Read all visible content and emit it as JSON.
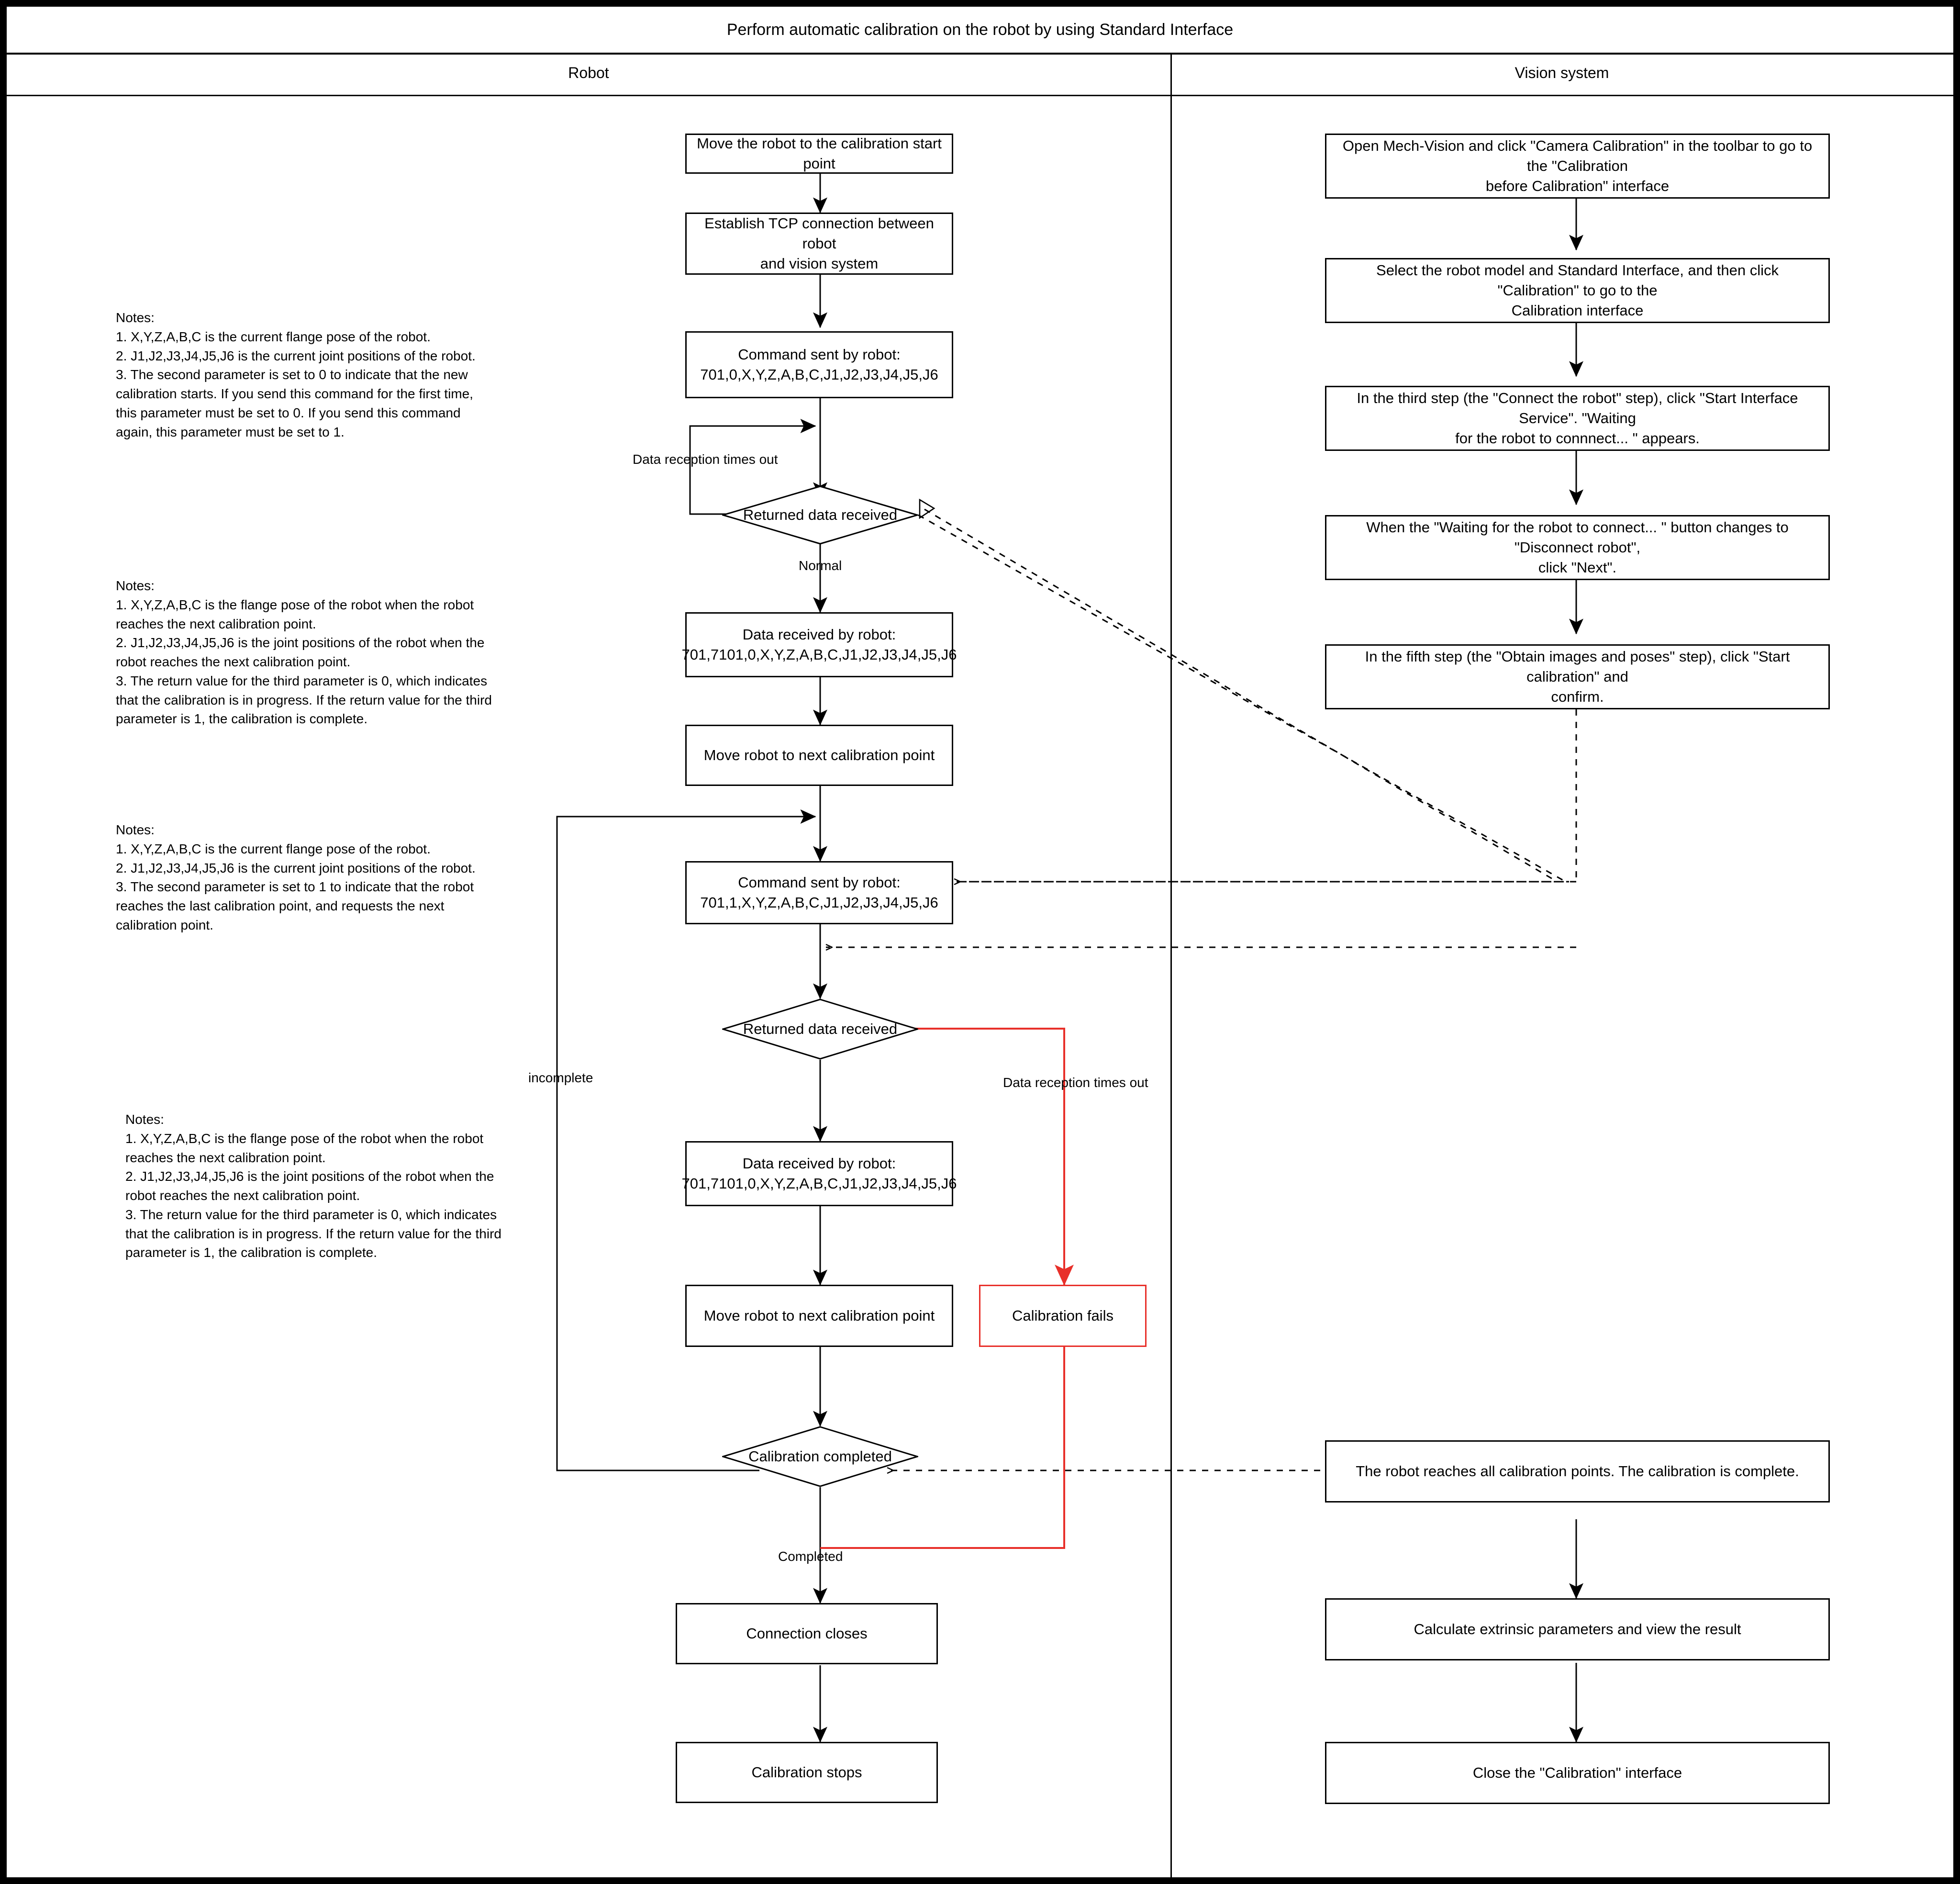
{
  "title": "Perform automatic calibration on the robot by using Standard Interface",
  "lanes": [
    {
      "label": "Robot"
    },
    {
      "label": "Vision system"
    }
  ],
  "colors": {
    "stroke": "#000000",
    "fail": "#e8302a",
    "background": "#ffffff",
    "page_border": "#000000"
  },
  "robot_nodes": [
    {
      "id": "r1",
      "text": "Move the robot to the calibration start point"
    },
    {
      "id": "r2",
      "text": "Establish TCP connection between robot\nand vision system"
    },
    {
      "id": "r3",
      "text": "Command sent by robot:\n701,0,X,Y,Z,A,B,C,J1,J2,J3,J4,J5,J6"
    },
    {
      "id": "r4",
      "text": "Returned data received"
    },
    {
      "id": "r5",
      "text": "Data received by robot:\n701,7101,0,X,Y,Z,A,B,C,J1,J2,J3,J4,J5,J6"
    },
    {
      "id": "r6",
      "text": "Move robot to next calibration point"
    },
    {
      "id": "r7",
      "text": "Command sent by robot:\n701,1,X,Y,Z,A,B,C,J1,J2,J3,J4,J5,J6"
    },
    {
      "id": "r8",
      "text": "Returned data received"
    },
    {
      "id": "r9",
      "text": "Data received by robot:\n701,7101,0,X,Y,Z,A,B,C,J1,J2,J3,J4,J5,J6"
    },
    {
      "id": "r10",
      "text": "Move robot to next calibration point"
    },
    {
      "id": "r11",
      "text": "Calibration fails"
    },
    {
      "id": "r12",
      "text": "Calibration completed"
    },
    {
      "id": "r13",
      "text": "Connection closes"
    },
    {
      "id": "r14",
      "text": "Calibration stops"
    }
  ],
  "vision_nodes": [
    {
      "id": "v1",
      "text": "Open Mech-Vision and click \"Camera Calibration\" in the toolbar to go to the \"Calibration\nbefore Calibration\" interface"
    },
    {
      "id": "v2",
      "text": "Select the robot model and Standard Interface, and then click \"Calibration\" to go to the\nCalibration interface"
    },
    {
      "id": "v3",
      "text": "In the third step (the \"Connect the robot\" step), click \"Start Interface Service\".  \"Waiting\nfor the robot to connnect... \" appears."
    },
    {
      "id": "v4",
      "text": "When the \"Waiting for the robot to connect... \" button changes to \"Disconnect robot\",\nclick \"Next\"."
    },
    {
      "id": "v5",
      "text": "In the fifth step (the \"Obtain images and poses\" step), click \"Start calibration\" and\nconfirm."
    },
    {
      "id": "v6",
      "text": "The robot reaches all calibration points. The calibration is complete."
    },
    {
      "id": "v7",
      "text": "Calculate extrinsic parameters and view the result"
    },
    {
      "id": "v8",
      "text": "Close the \"Calibration\" interface"
    }
  ],
  "edge_labels": [
    {
      "id": "e1",
      "text": "Data reception times out"
    },
    {
      "id": "e2",
      "text": "Normal"
    },
    {
      "id": "e3",
      "text": "incomplete"
    },
    {
      "id": "e4",
      "text": "Data reception times out"
    },
    {
      "id": "e5",
      "text": "Completed"
    }
  ],
  "notes": [
    {
      "id": "n1",
      "text": "Notes:\n1. X,Y,Z,A,B,C is the current flange pose of the robot.\n2. J1,J2,J3,J4,J5,J6 is the current joint positions of the robot.\n3. The second parameter is set to 0 to indicate that the new\ncalibration starts. If you send this command for the first time,\nthis parameter must be set to 0. If you send this command\nagain, this parameter must be set to 1."
    },
    {
      "id": "n2",
      "text": "Notes:\n1. X,Y,Z,A,B,C is the flange pose of the robot when the robot\nreaches the next calibration point.\n2. J1,J2,J3,J4,J5,J6 is the joint positions of the robot when the\nrobot reaches the next calibration point.\n3. The return value for the third parameter is 0, which indicates\nthat the calibration is in progress. If the return value for the third\nparameter is 1, the calibration is complete."
    },
    {
      "id": "n3",
      "text": "Notes:\n1. X,Y,Z,A,B,C is the current flange pose of the robot.\n2. J1,J2,J3,J4,J5,J6 is the current joint positions of the robot.\n3. The second parameter is set to 1 to indicate that the robot\nreaches the last calibration point, and requests the next\ncalibration point."
    },
    {
      "id": "n4",
      "text": "Notes:\n1. X,Y,Z,A,B,C is the flange pose of the robot when the robot\nreaches the next calibration point.\n2. J1,J2,J3,J4,J5,J6 is the joint positions of the robot when the\nrobot reaches the next calibration point.\n3. The return value for the third parameter is 0, which indicates\nthat the calibration is in progress. If the return value for the third\nparameter is 1, the calibration is complete."
    }
  ]
}
